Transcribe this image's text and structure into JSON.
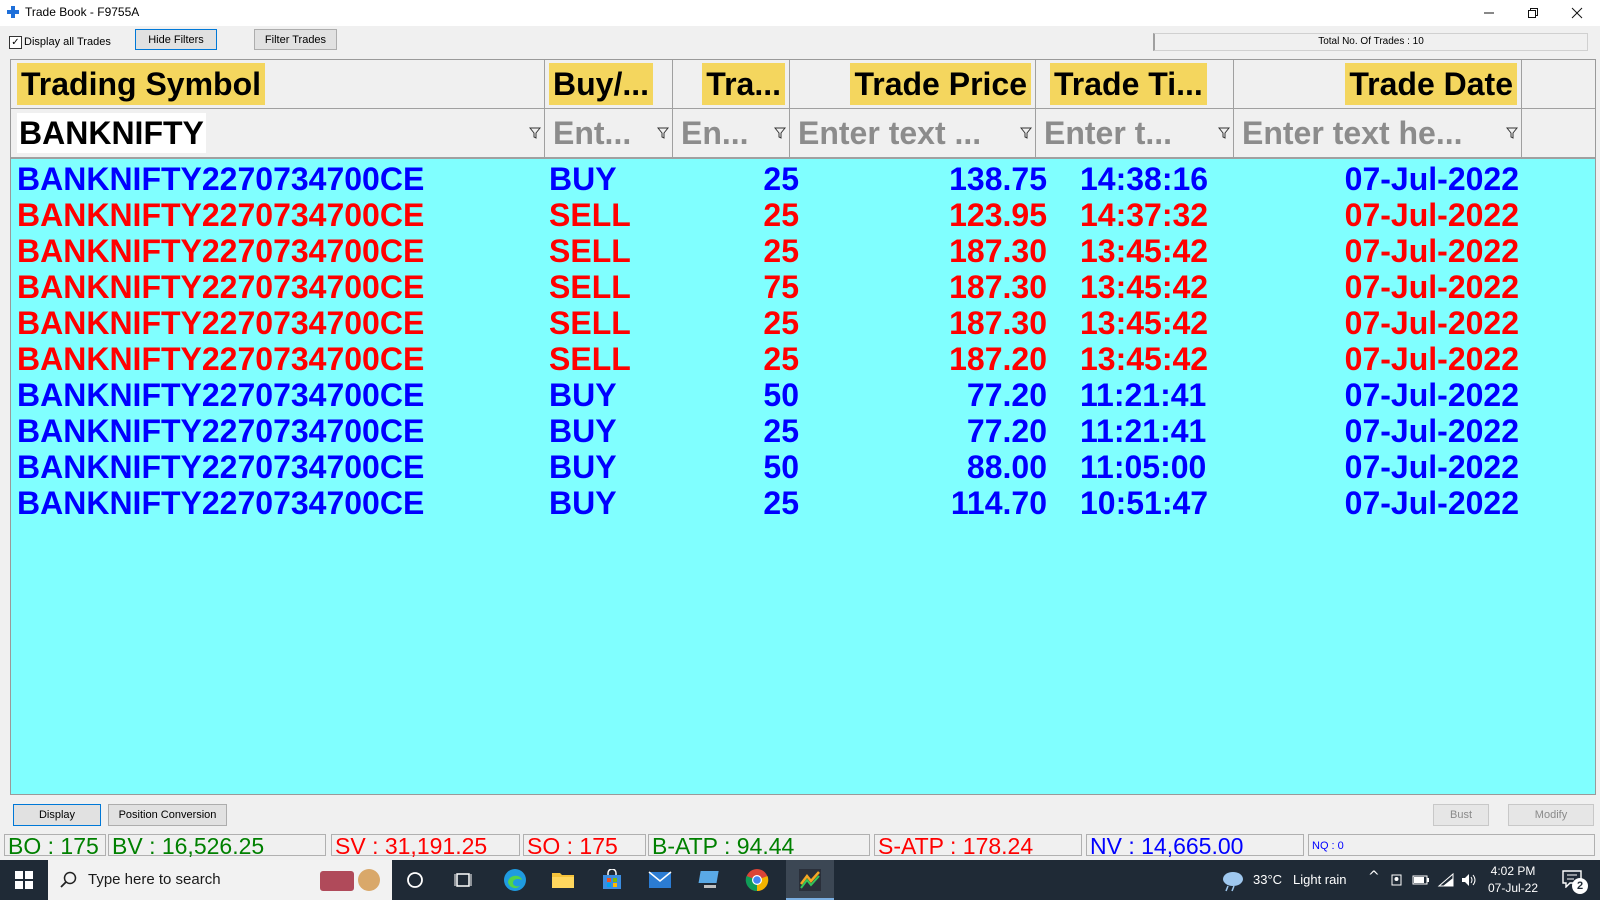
{
  "window": {
    "title": "Trade Book - F9755A"
  },
  "toolbar": {
    "display_all_label": "Display all Trades",
    "display_all_checked": true,
    "hide_filters_label": "Hide Filters",
    "filter_trades_label": "Filter Trades",
    "total_trades_text": "Total No. Of Trades : 10"
  },
  "table": {
    "columns": [
      "Trading Symbol",
      "Buy/...",
      "Tra...",
      "Trade Price",
      "Trade Ti...",
      "Trade Date"
    ],
    "filters": [
      {
        "value": "BANKNIFTY",
        "placeholder": ""
      },
      {
        "value": "",
        "placeholder": "Ent..."
      },
      {
        "value": "",
        "placeholder": "En..."
      },
      {
        "value": "",
        "placeholder": "Enter text ..."
      },
      {
        "value": "",
        "placeholder": "Enter t..."
      },
      {
        "value": "",
        "placeholder": "Enter text he..."
      }
    ],
    "rows": [
      {
        "symbol": "BANKNIFTY2270734700CE",
        "side": "BUY",
        "qty": "25",
        "price": "138.75",
        "time": "14:38:16",
        "date": "07-Jul-2022"
      },
      {
        "symbol": "BANKNIFTY2270734700CE",
        "side": "SELL",
        "qty": "25",
        "price": "123.95",
        "time": "14:37:32",
        "date": "07-Jul-2022"
      },
      {
        "symbol": "BANKNIFTY2270734700CE",
        "side": "SELL",
        "qty": "25",
        "price": "187.30",
        "time": "13:45:42",
        "date": "07-Jul-2022"
      },
      {
        "symbol": "BANKNIFTY2270734700CE",
        "side": "SELL",
        "qty": "75",
        "price": "187.30",
        "time": "13:45:42",
        "date": "07-Jul-2022"
      },
      {
        "symbol": "BANKNIFTY2270734700CE",
        "side": "SELL",
        "qty": "25",
        "price": "187.30",
        "time": "13:45:42",
        "date": "07-Jul-2022"
      },
      {
        "symbol": "BANKNIFTY2270734700CE",
        "side": "SELL",
        "qty": "25",
        "price": "187.20",
        "time": "13:45:42",
        "date": "07-Jul-2022"
      },
      {
        "symbol": "BANKNIFTY2270734700CE",
        "side": "BUY",
        "qty": "50",
        "price": "77.20",
        "time": "11:21:41",
        "date": "07-Jul-2022"
      },
      {
        "symbol": "BANKNIFTY2270734700CE",
        "side": "BUY",
        "qty": "25",
        "price": "77.20",
        "time": "11:21:41",
        "date": "07-Jul-2022"
      },
      {
        "symbol": "BANKNIFTY2270734700CE",
        "side": "BUY",
        "qty": "50",
        "price": "88.00",
        "time": "11:05:00",
        "date": "07-Jul-2022"
      },
      {
        "symbol": "BANKNIFTY2270734700CE",
        "side": "BUY",
        "qty": "25",
        "price": "114.70",
        "time": "10:51:47",
        "date": "07-Jul-2022"
      }
    ]
  },
  "bottom": {
    "display_label": "Display",
    "position_conversion_label": "Position Conversion",
    "bust_label": "Bust",
    "modify_label": "Modify"
  },
  "stats": {
    "bo": "BO : 175",
    "bv": "BV : 16,526.25",
    "sv": "SV : 31,191.25",
    "so": "SO : 175",
    "batp": "B-ATP : 94.44",
    "satp": "S-ATP : 178.24",
    "nv": "NV : 14,665.00",
    "nq": "NQ : 0"
  },
  "taskbar": {
    "search_placeholder": "Type here to search",
    "weather_temp": "33°C",
    "weather_desc": "Light rain",
    "time": "4:02 PM",
    "date": "07-Jul-22",
    "notification_count": "2"
  },
  "colors": {
    "grid_bg": "#80ffff",
    "header_highlight": "#f4d65e",
    "buy": "#0000ff",
    "sell": "#ff0000",
    "stat_green": "#008000",
    "stat_red": "#ff0000",
    "stat_blue": "#0000ff",
    "taskbar_bg": "#1f2a36"
  },
  "icons": {
    "app": "app-icon",
    "funnel": "funnel-icon",
    "search": "search-icon"
  }
}
